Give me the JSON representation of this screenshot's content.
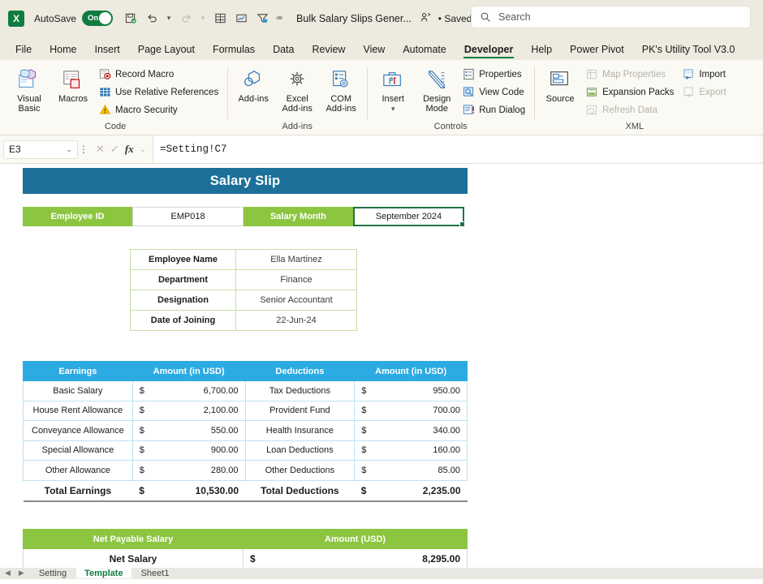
{
  "titlebar": {
    "app_icon": "excel-logo",
    "autosave_label": "AutoSave",
    "autosave_state": "On",
    "document_title": "Bulk Salary Slips Gener...",
    "saved_status": "• Saved",
    "quick_access": [
      {
        "name": "save-icon",
        "glyph": "὚B"
      },
      {
        "name": "undo-icon",
        "glyph": "↶"
      },
      {
        "name": "undo-dropdown-icon",
        "glyph": "⌄"
      },
      {
        "name": "redo-icon",
        "glyph": "↷"
      },
      {
        "name": "redo-dropdown-icon",
        "glyph": "⌄"
      },
      {
        "name": "table-icon",
        "glyph": "⊞"
      },
      {
        "name": "chart-icon",
        "glyph": "◰"
      },
      {
        "name": "filter-icon",
        "glyph": "∇"
      },
      {
        "name": "customize-qat-icon",
        "glyph": "⩟"
      }
    ],
    "share_icon": "share-person-icon",
    "saved_chevron": "⌄"
  },
  "search": {
    "icon": "search-icon",
    "placeholder": "Search"
  },
  "ribbon_tabs": [
    {
      "label": "File",
      "active": false
    },
    {
      "label": "Home",
      "active": false
    },
    {
      "label": "Insert",
      "active": false
    },
    {
      "label": "Page Layout",
      "active": false
    },
    {
      "label": "Formulas",
      "active": false
    },
    {
      "label": "Data",
      "active": false
    },
    {
      "label": "Review",
      "active": false
    },
    {
      "label": "View",
      "active": false
    },
    {
      "label": "Automate",
      "active": false
    },
    {
      "label": "Developer",
      "active": true
    },
    {
      "label": "Help",
      "active": false
    },
    {
      "label": "Power Pivot",
      "active": false
    },
    {
      "label": "PK's Utility Tool V3.0",
      "active": false
    }
  ],
  "ribbon_groups": [
    {
      "name": "code",
      "label": "Code",
      "big_buttons": [
        {
          "label": "Visual Basic",
          "icon": "visual-basic-icon"
        },
        {
          "label": "Macros",
          "icon": "macros-icon"
        }
      ],
      "small_buttons": [
        {
          "label": "Record Macro",
          "icon": "record-macro-icon",
          "disabled": false
        },
        {
          "label": "Use Relative References",
          "icon": "relative-references-icon",
          "disabled": false
        },
        {
          "label": "Macro Security",
          "icon": "macro-security-icon",
          "disabled": false
        }
      ]
    },
    {
      "name": "add-ins",
      "label": "Add-ins",
      "big_buttons": [
        {
          "label": "Add-ins",
          "icon": "add-ins-icon"
        },
        {
          "label": "Excel Add-ins",
          "icon": "excel-add-ins-icon"
        },
        {
          "label": "COM Add-ins",
          "icon": "com-add-ins-icon"
        }
      ],
      "small_buttons": []
    },
    {
      "name": "controls",
      "label": "Controls",
      "big_buttons": [
        {
          "label": "Insert",
          "icon": "insert-control-icon",
          "has_dropdown": true
        },
        {
          "label": "Design Mode",
          "icon": "design-mode-icon"
        }
      ],
      "small_buttons": [
        {
          "label": "Properties",
          "icon": "properties-icon",
          "disabled": false
        },
        {
          "label": "View Code",
          "icon": "view-code-icon",
          "disabled": false
        },
        {
          "label": "Run Dialog",
          "icon": "run-dialog-icon",
          "disabled": false
        }
      ]
    },
    {
      "name": "xml",
      "label": "XML",
      "big_buttons": [
        {
          "label": "Source",
          "icon": "xml-source-icon"
        }
      ],
      "small_buttons": [
        {
          "label": "Map Properties",
          "icon": "map-properties-icon",
          "disabled": true
        },
        {
          "label": "Expansion Packs",
          "icon": "expansion-packs-icon",
          "disabled": false
        },
        {
          "label": "Refresh Data",
          "icon": "refresh-data-icon",
          "disabled": true
        },
        {
          "label": "Import",
          "icon": "import-icon",
          "disabled": false
        },
        {
          "label": "Export",
          "icon": "export-icon",
          "disabled": true
        }
      ]
    }
  ],
  "formula_bar": {
    "name_box_value": "E3",
    "name_box_chevron": "⌄",
    "cancel_icon": "cancel-icon",
    "enter_icon": "enter-icon",
    "fx_icon": "fx-icon",
    "fx_chevron": "⌄",
    "formula": "=Setting!C7"
  },
  "sheet": {
    "title_banner": "Salary Slip",
    "id_row": {
      "employee_id_label": "Employee ID",
      "employee_id_value": "EMP018",
      "salary_month_label": "Salary Month",
      "salary_month_value": "September 2024"
    },
    "employee_details": [
      {
        "key": "Employee Name",
        "value": "Ella Martinez"
      },
      {
        "key": "Department",
        "value": "Finance"
      },
      {
        "key": "Designation",
        "value": "Senior Accountant"
      },
      {
        "key": "Date of Joining",
        "value": "22-Jun-24"
      }
    ],
    "earnings_deductions": {
      "headers": [
        "Earnings",
        "Amount (in USD)",
        "Deductions",
        "Amount (in USD)"
      ],
      "currency": "$",
      "rows": [
        {
          "earning": "Basic Salary",
          "earning_amount": "6,700.00",
          "deduction": "Tax Deductions",
          "deduction_amount": "950.00"
        },
        {
          "earning": "House Rent Allowance",
          "earning_amount": "2,100.00",
          "deduction": "Provident Fund",
          "deduction_amount": "700.00"
        },
        {
          "earning": "Conveyance Allowance",
          "earning_amount": "550.00",
          "deduction": "Health Insurance",
          "deduction_amount": "340.00"
        },
        {
          "earning": "Special Allowance",
          "earning_amount": "900.00",
          "deduction": "Loan Deductions",
          "deduction_amount": "160.00"
        },
        {
          "earning": "Other Allowance",
          "earning_amount": "280.00",
          "deduction": "Other Deductions",
          "deduction_amount": "85.00"
        }
      ],
      "total": {
        "earnings_label": "Total Earnings",
        "earnings_amount": "10,530.00",
        "deductions_label": "Total Deductions",
        "deductions_amount": "2,235.00"
      }
    },
    "net_payable": {
      "header_left": "Net Payable Salary",
      "header_right": "Amount (USD)",
      "row_label": "Net Salary",
      "currency": "$",
      "row_amount": "8,295.00"
    }
  },
  "sheet_tabs": {
    "nav_icons": [
      "◀",
      "▶"
    ],
    "tabs": [
      {
        "label": "Setting",
        "active": false
      },
      {
        "label": "Template",
        "active": true
      },
      {
        "label": "Sheet1",
        "active": false
      }
    ]
  },
  "colors": {
    "title_banner": "#1C7099",
    "green_header": "#8CC640",
    "blue_header": "#2BABE2",
    "excel_green": "#107C41",
    "selection_border": "#217346",
    "chrome_bg": "#EDEBDF",
    "ribbon_bg": "#FAF9F3"
  }
}
